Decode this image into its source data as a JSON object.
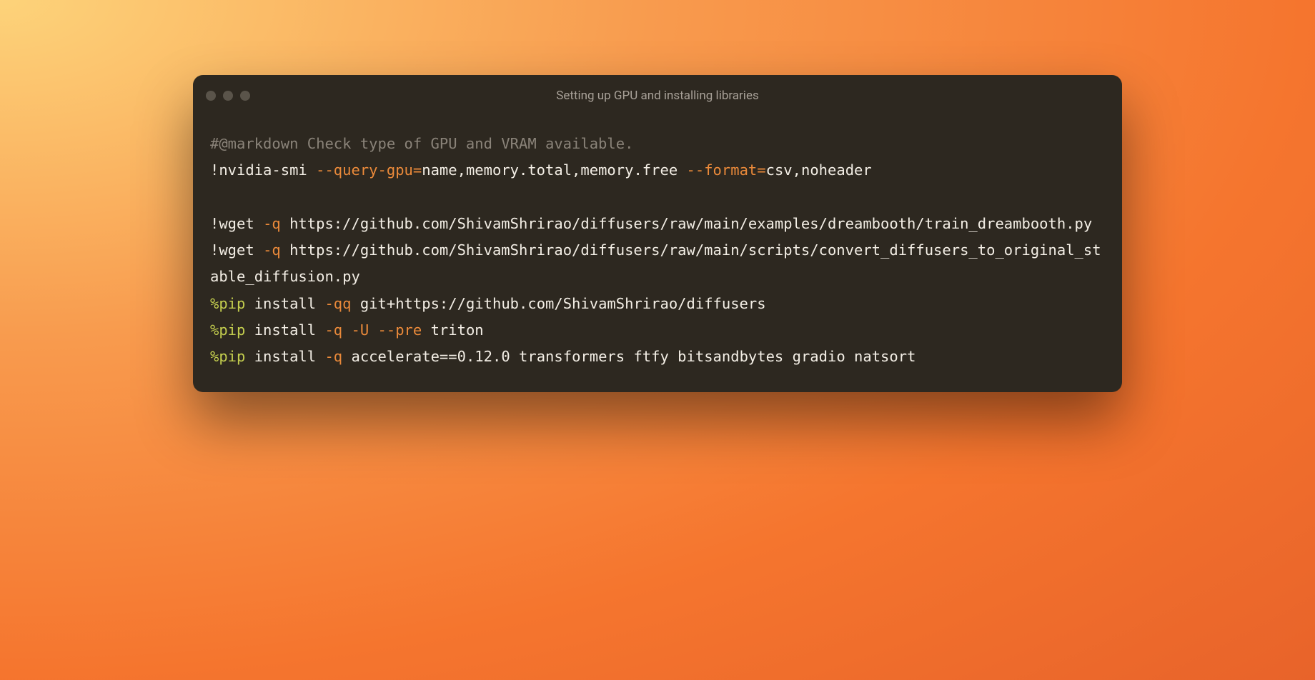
{
  "window": {
    "title": "Setting up GPU and installing libraries"
  },
  "code": {
    "line1_comment": "#@markdown Check type of GPU and VRAM available.",
    "line2_bang": "!",
    "line2_cmd": "nvidia",
    "line2_dash1": "-",
    "line2_smi": "smi ",
    "line2_flag1": "--query-gpu",
    "line2_eq1": "=",
    "line2_val1": "name,memory",
    "line2_dot1": ".",
    "line2_val2": "total,memory",
    "line2_dot2": ".",
    "line2_val3": "free ",
    "line2_flag2": "--format",
    "line2_eq2": "=",
    "line2_val4": "csv,noheader",
    "line4_bang": "!",
    "line4_cmd": "wget ",
    "line4_flag": "-q",
    "line4_url": " https://github.com/ShivamShrirao/diffusers/raw/main/examples/dreambooth/train_dreambooth.py",
    "line5_bang": "!",
    "line5_cmd": "wget ",
    "line5_flag": "-q",
    "line5_url": " https://github.com/ShivamShrirao/diffusers/raw/main/scripts/convert_diffusers_to_original_stable_diffusion.py",
    "line6_magic": "%pip",
    "line6_rest1": " install ",
    "line6_flag": "-qq",
    "line6_rest2": " git",
    "line6_plus": "+",
    "line6_url": "https://github.com/ShivamShrirao/diffusers",
    "line7_magic": "%pip",
    "line7_rest1": " install ",
    "line7_flag1": "-q",
    "line7_sp1": " ",
    "line7_flag2": "-U",
    "line7_sp2": " ",
    "line7_flag3": "--pre",
    "line7_rest2": " triton",
    "line8_magic": "%pip",
    "line8_rest1": " install ",
    "line8_flag1": "-q",
    "line8_rest2": " accelerate",
    "line8_eq": "==",
    "line8_ver": "0.12.0",
    "line8_rest3": " transformers ftfy bitsandbytes gradio natsort"
  }
}
